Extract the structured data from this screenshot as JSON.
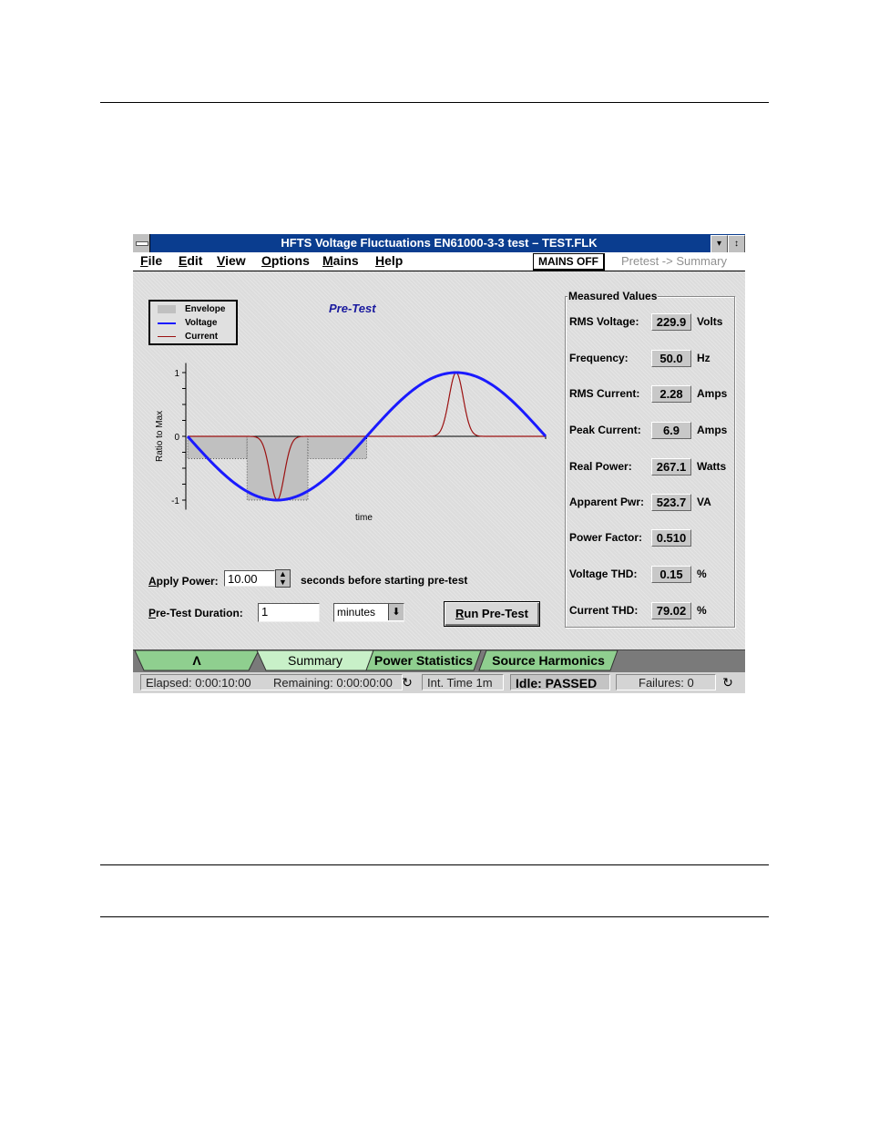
{
  "window": {
    "title": "HFTS Voltage Fluctuations EN61000-3-3 test – TEST.FLK",
    "minimize_glyph": "▾",
    "restore_glyph": "↕"
  },
  "menubar": {
    "items": [
      {
        "underline": "F",
        "rest": "ile"
      },
      {
        "underline": "E",
        "rest": "dit"
      },
      {
        "underline": "V",
        "rest": "iew"
      },
      {
        "underline": "O",
        "rest": "ptions"
      },
      {
        "underline": "M",
        "rest": "ains"
      },
      {
        "underline": "H",
        "rest": "elp"
      }
    ],
    "mains_status": "MAINS OFF",
    "mode": "Pretest -> Summary"
  },
  "plot": {
    "title": "Pre-Test",
    "legend": [
      {
        "label": "Envelope",
        "color": "#c0c0c0"
      },
      {
        "label": "Voltage",
        "color": "#1a1aff"
      },
      {
        "label": "Current",
        "color": "#9b1111"
      }
    ]
  },
  "chart_data": {
    "type": "line",
    "title": "Pre-Test",
    "xlabel": "time",
    "ylabel": "Ratio to Max",
    "ylim": [
      -1.15,
      1.15
    ],
    "xlim": [
      0,
      1
    ],
    "yticks": [
      1,
      0,
      -1
    ],
    "ytick_labels": [
      "1",
      "0",
      "-1"
    ],
    "series": [
      {
        "name": "Voltage",
        "function": "-sin(2*pi*t)",
        "color": "#1a1aff"
      },
      {
        "name": "Current",
        "peaks": [
          {
            "t": 0.25,
            "value": -1.0
          },
          {
            "t": 0.75,
            "value": 1.0
          }
        ],
        "color": "#9b1111"
      },
      {
        "name": "Envelope",
        "steps": [
          {
            "t0": 0.0,
            "t1": 0.166,
            "low": -0.35
          },
          {
            "t0": 0.166,
            "t1": 0.336,
            "low": -1.0
          },
          {
            "t0": 0.336,
            "t1": 0.5,
            "low": -0.35
          }
        ],
        "color": "#c0c0c0"
      }
    ],
    "legend_position": "top-left"
  },
  "measured": {
    "title": "Measured Values",
    "rows": [
      {
        "label": "RMS Voltage:",
        "value": "229.9",
        "unit": "Volts"
      },
      {
        "label": "Frequency:",
        "value": "50.0",
        "unit": "Hz"
      },
      {
        "label": "RMS Current:",
        "value": "2.28",
        "unit": "Amps"
      },
      {
        "label": "Peak Current:",
        "value": "6.9",
        "unit": "Amps"
      },
      {
        "label": "Real Power:",
        "value": "267.1",
        "unit": "Watts"
      },
      {
        "label": "Apparent Pwr:",
        "value": "523.7",
        "unit": "VA"
      },
      {
        "label": "Power Factor:",
        "value": "0.510",
        "unit": ""
      },
      {
        "label": "Voltage THD:",
        "value": "0.15",
        "unit": "%"
      },
      {
        "label": "Current THD:",
        "value": "79.02",
        "unit": "%"
      }
    ]
  },
  "form": {
    "apply_power_ul": "A",
    "apply_power_rest": "pply Power:",
    "apply_power_value": "10.00",
    "apply_power_suffix": "seconds before starting pre-test",
    "duration_ul": "P",
    "duration_rest": "re-Test Duration:",
    "duration_value": "1",
    "duration_unit": "minutes",
    "run_ul": "R",
    "run_rest": "un Pre-Test"
  },
  "tabs": [
    {
      "label": "Λ",
      "active": false
    },
    {
      "label": "Summary",
      "active": true
    },
    {
      "label": "Power Statistics",
      "active": false
    },
    {
      "label": "Source Harmonics",
      "active": false
    }
  ],
  "status": {
    "elapsed": "Elapsed: 0:00:10:00",
    "remaining": "Remaining: 0:00:00:00",
    "int_time": "Int. Time 1m",
    "state": "Idle: PASSED",
    "failures": "Failures: 0",
    "refresh_glyph": "↻"
  }
}
